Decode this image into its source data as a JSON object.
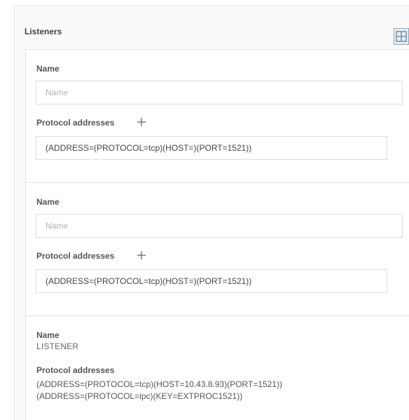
{
  "listeners": {
    "title": "Listeners",
    "add_icon": "grid-add-icon",
    "editable": [
      {
        "name_label": "Name",
        "name_placeholder": "Name",
        "name_value": "",
        "protocol_label": "Protocol addresses",
        "protocol_add_icon": "plus-icon",
        "protocol_value": "(ADDRESS=(PROTOCOL=tcp)(HOST=)(PORT=1521))"
      },
      {
        "name_label": "Name",
        "name_placeholder": "Name",
        "name_value": "",
        "protocol_label": "Protocol addresses",
        "protocol_add_icon": "plus-icon",
        "protocol_value": "(ADDRESS=(PROTOCOL=tcp)(HOST=)(PORT=1521))"
      }
    ],
    "readonly": {
      "name_label": "Name",
      "name_value": "LISTENER",
      "protocol_label": "Protocol addresses",
      "protocol_values": [
        "(ADDRESS=(PROTOCOL=tcp)(HOST=10.43.8.93)(PORT=1521))",
        "(ADDRESS=(PROTOCOL=ipc)(KEY=EXTPROC1521))"
      ]
    }
  }
}
